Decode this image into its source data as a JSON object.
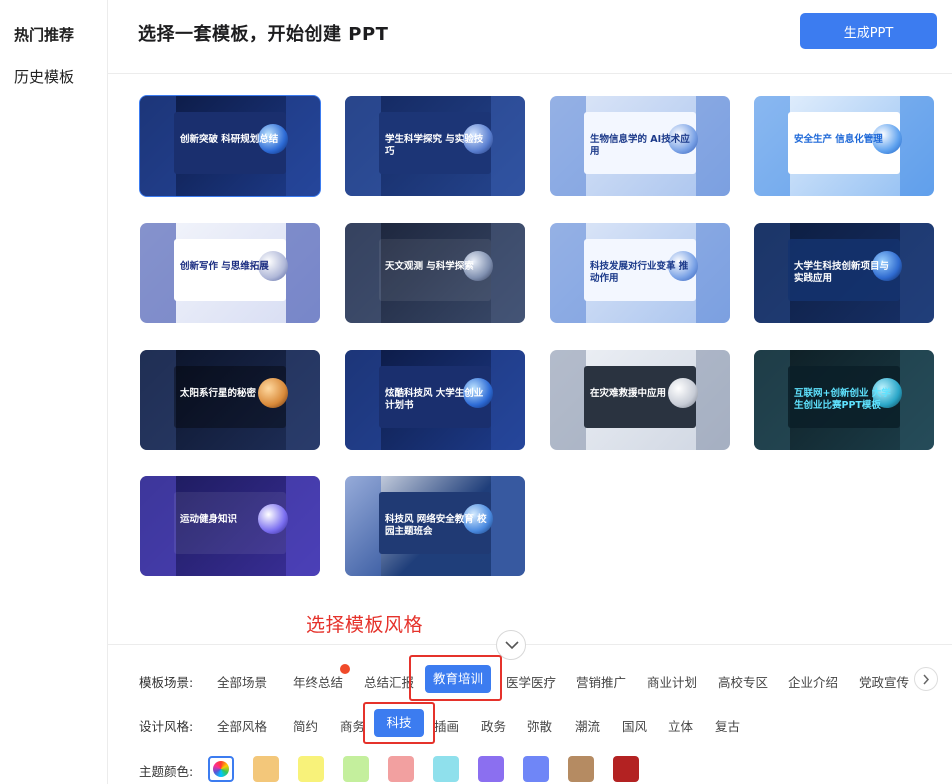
{
  "sidebar": {
    "items": [
      {
        "label": "热门推荐"
      },
      {
        "label": "历史模板"
      }
    ]
  },
  "header": {
    "title": "选择一套模板，开始创建 PPT",
    "generate_label": "生成PPT"
  },
  "templates": [
    {
      "title": "创新突破 科研规划总结",
      "theme": "dark-blue",
      "selected": true
    },
    {
      "title": "学生科学探究 与实验技巧",
      "theme": "navy"
    },
    {
      "title": "生物信息学的 AI技术应用",
      "theme": "light-blue"
    },
    {
      "title": "安全生产 信息化管理",
      "theme": "sky"
    },
    {
      "title": "创新写作 与思维拓展",
      "theme": "white-blue"
    },
    {
      "title": "天文观测 与科学探索",
      "theme": "night"
    },
    {
      "title": "科技发展对行业变革 推动作用",
      "theme": "light-blue"
    },
    {
      "title": "大学生科技创新项目与实践应用",
      "theme": "dark-navy"
    },
    {
      "title": "太阳系行星的秘密",
      "theme": "space"
    },
    {
      "title": "炫酷科技风 大学生创业计划书",
      "theme": "dark-blue"
    },
    {
      "title": "在灾难救援中应用",
      "theme": "light-grey"
    },
    {
      "title": "互联网+创新创业 大学生创业比赛PPT模板",
      "theme": "teal-dark"
    },
    {
      "title": "运动健身知识",
      "theme": "purple"
    },
    {
      "title": "科技风 网络安全教育 校园主题班会",
      "theme": "dark-white"
    }
  ],
  "annotation": "选择模板风格",
  "filters": {
    "scene_label": "模板场景:",
    "scenes": [
      {
        "label": "全部场景"
      },
      {
        "label": "年终总结",
        "hot": true
      },
      {
        "label": "总结汇报"
      },
      {
        "label": "教育培训",
        "active": true
      },
      {
        "label": "医学医疗"
      },
      {
        "label": "营销推广"
      },
      {
        "label": "商业计划"
      },
      {
        "label": "高校专区"
      },
      {
        "label": "企业介绍"
      },
      {
        "label": "党政宣传"
      }
    ],
    "style_label": "设计风格:",
    "styles": [
      {
        "label": "全部风格"
      },
      {
        "label": "简约"
      },
      {
        "label": "商务"
      },
      {
        "label": "科技",
        "active": true
      },
      {
        "label": "插画"
      },
      {
        "label": "政务"
      },
      {
        "label": "弥散"
      },
      {
        "label": "潮流"
      },
      {
        "label": "国风"
      },
      {
        "label": "立体"
      },
      {
        "label": "复古"
      }
    ],
    "color_label": "主题颜色:",
    "colors": [
      "rainbow",
      "#f3c77a",
      "#f8f27a",
      "#c4ef9d",
      "#f2a0a0",
      "#8fe0ec",
      "#8b6ff0",
      "#6f86f7",
      "#b58b62",
      "#b32222"
    ]
  }
}
